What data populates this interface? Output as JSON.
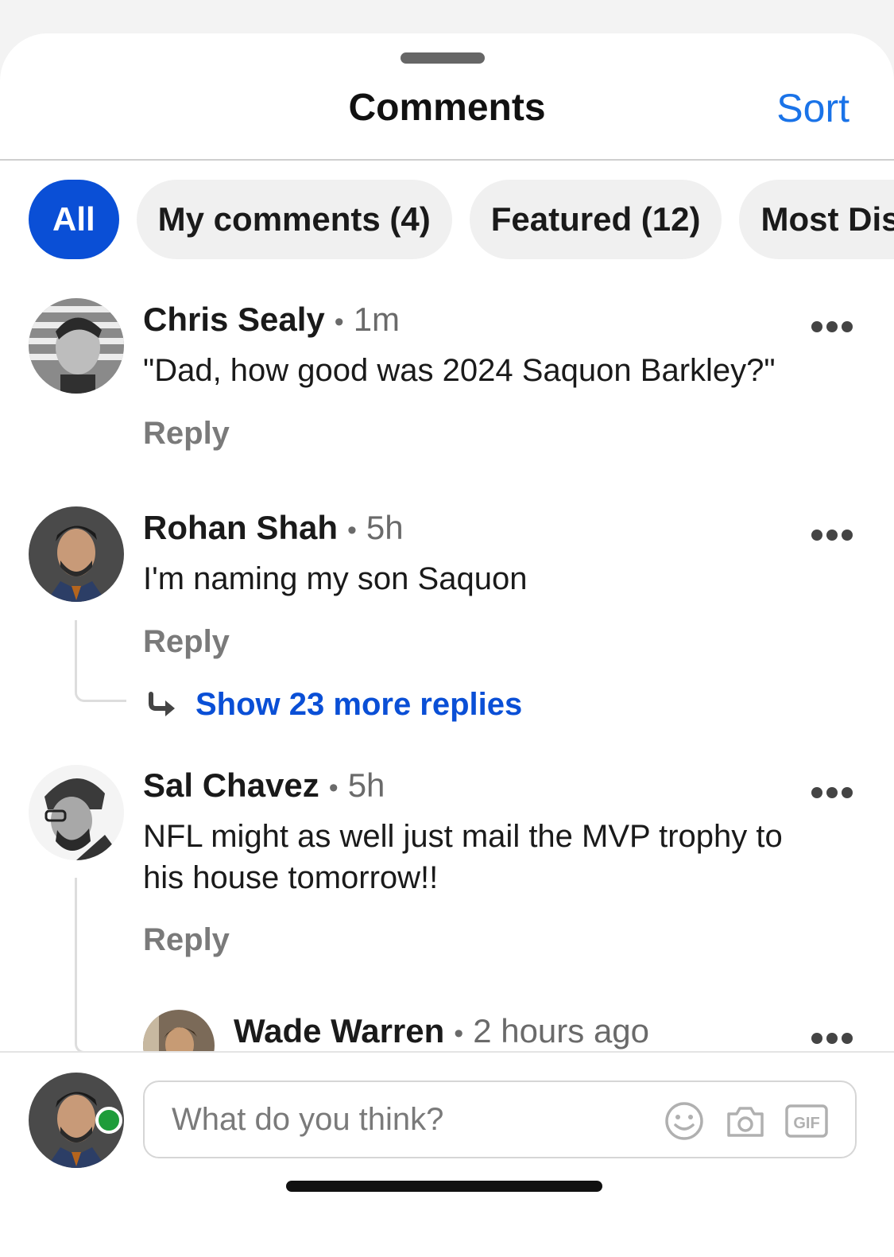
{
  "header": {
    "title": "Comments",
    "sort_label": "Sort"
  },
  "filters": [
    {
      "label": "All",
      "active": true
    },
    {
      "label": "My comments (4)",
      "active": false
    },
    {
      "label": "Featured (12)",
      "active": false
    },
    {
      "label": "Most Disc",
      "active": false
    }
  ],
  "comments": [
    {
      "author": "Chris Sealy",
      "time": "1m",
      "text": "\"Dad, how good was 2024 Saquon Barkley?\"",
      "reply_label": "Reply"
    },
    {
      "author": "Rohan Shah",
      "time": "5h",
      "text": "I'm naming my son Saquon",
      "reply_label": "Reply",
      "show_more_replies": "Show 23 more replies"
    },
    {
      "author": "Sal Chavez",
      "time": "5h",
      "text": "NFL might as well just mail the MVP trophy to his house tomorrow!!",
      "reply_label": "Reply"
    }
  ],
  "nested_reply": {
    "author": "Wade Warren",
    "time": "2 hours ago"
  },
  "composer": {
    "placeholder": "What do you think?",
    "icons": [
      "emoji-icon",
      "camera-icon",
      "gif-icon"
    ],
    "gif_label": "GIF"
  },
  "colors": {
    "accent": "#0a4fd6",
    "sort_link": "#1a73e8",
    "online": "#1e9c3a"
  }
}
